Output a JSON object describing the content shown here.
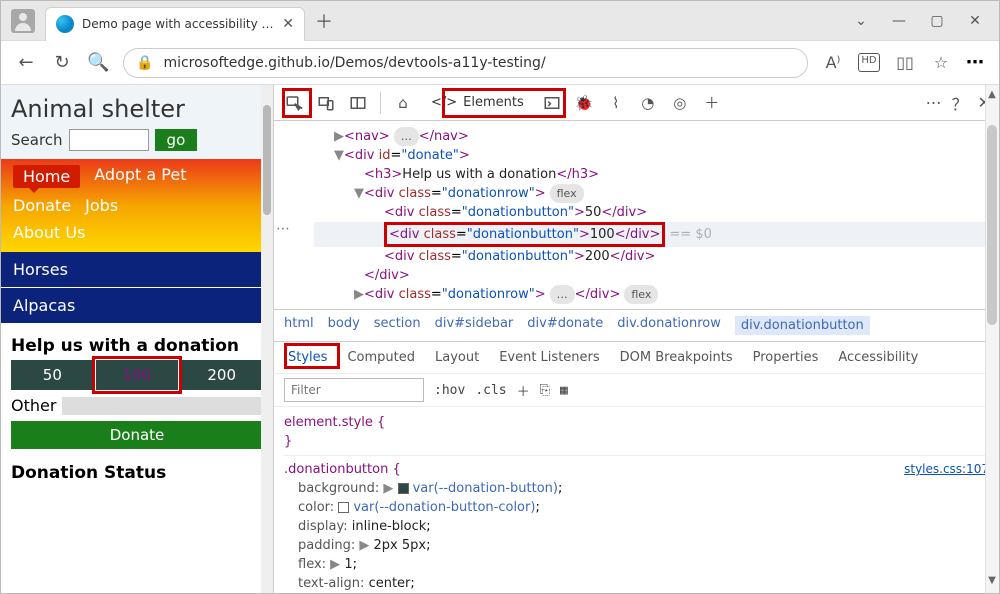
{
  "window": {
    "tabTitle": "Demo page with accessibility issu",
    "url": "microsoftedge.github.io/Demos/devtools-a11y-testing/"
  },
  "site": {
    "title": "Animal shelter",
    "searchLabel": "Search",
    "goLabel": "go",
    "nav": {
      "home": "Home",
      "adopt": "Adopt a Pet",
      "donate": "Donate",
      "jobs": "Jobs",
      "about": "About Us"
    },
    "animals": {
      "horses": "Horses",
      "alpacas": "Alpacas"
    },
    "donationHeading": "Help us with a donation",
    "amounts": {
      "a50": "50",
      "a100": "100",
      "a200": "200"
    },
    "otherLabel": "Other",
    "donateLabel": "Donate",
    "statusHeading": "Donation Status"
  },
  "devtools": {
    "elementsTab": "Elements",
    "dom": {
      "navOpen": "<nav>",
      "navEll": "…",
      "navClose": "</nav>",
      "divDonateOpen": "<div id=\"donate\">",
      "h3Open": "<h3>",
      "h3Text": "Help us with a donation",
      "h3Close": "</h3>",
      "donRowOpen": "<div class=\"donationrow\">",
      "flex": "flex",
      "btn50Open": "<div class=\"donationbutton\">",
      "btn50Text": "50",
      "btn50Close": "</div>",
      "btn100Open": "<div class=\"donationbutton\">",
      "btn100Text": "100",
      "btn100Close": "</div>",
      "eq0": "== $0",
      "btn200Open": "<div class=\"donationbutton\">",
      "btn200Text": "200",
      "btn200Close": "</div>",
      "divClose": "</div>",
      "donRow2Open": "<div class=\"donationrow\">",
      "donRow2Ell": "…",
      "donRow2Close": "</div>"
    },
    "crumbs": {
      "html": "html",
      "body": "body",
      "section": "section",
      "sidebar": "div#sidebar",
      "donate": "div#donate",
      "row": "div.donationrow",
      "btn": "div.donationbutton"
    },
    "panels": {
      "styles": "Styles",
      "computed": "Computed",
      "layout": "Layout",
      "listeners": "Event Listeners",
      "dom": "DOM Breakpoints",
      "props": "Properties",
      "a11y": "Accessibility"
    },
    "filter": {
      "placeholder": "Filter",
      "hov": ":hov",
      "cls": ".cls"
    },
    "css": {
      "elStyle": "element.style {",
      "close": "}",
      "selector": ".donationbutton {",
      "link": "styles.css:107",
      "bg": "background:",
      "bgVar": "var(--donation-button)",
      "color": "color:",
      "colorVar": "var(--donation-button-color)",
      "display": "display:",
      "displayVal": "inline-block",
      "padding": "padding:",
      "paddingVal": "2px 5px",
      "flex": "flex:",
      "flexVal": "1",
      "ta": "text-align:",
      "taVal": "center"
    }
  }
}
